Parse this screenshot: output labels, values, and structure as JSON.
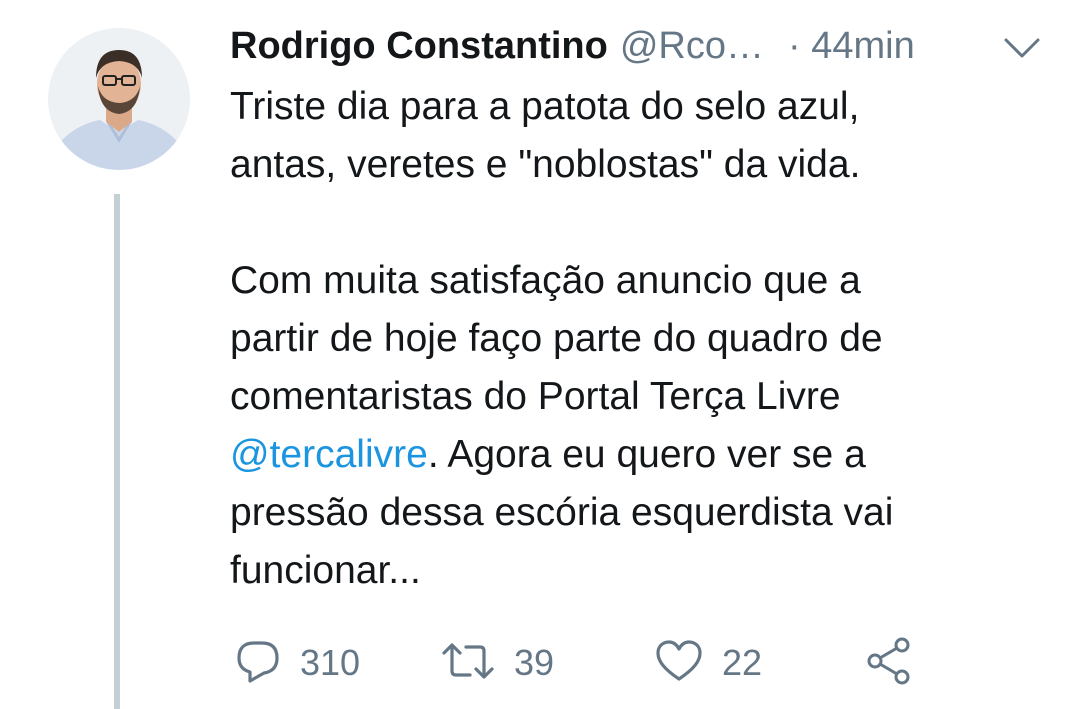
{
  "tweet": {
    "author_name": "Rodrigo Constantino",
    "author_handle": "@Rco…",
    "time": "· 44min",
    "paragraph1_line1": "Triste dia para a patota do selo azul,",
    "paragraph1_line2": "antas, veretes e \"noblostas\" da vida.",
    "paragraph2_line1": "Com muita satisfação anuncio que a",
    "paragraph2_line2": "partir de hoje faço parte do quadro de",
    "paragraph2_line3": "comentaristas do Portal Terça Livre",
    "mention": "@tercalivre",
    "paragraph2_line4_rest": ". Agora eu quero ver se a",
    "paragraph2_line5": "pressão dessa escória esquerdista vai",
    "paragraph2_line6": "funcionar..."
  },
  "actions": {
    "replies": "310",
    "retweets": "39",
    "likes": "22"
  },
  "icons": {
    "reply": "reply-icon",
    "retweet": "retweet-icon",
    "like": "heart-icon",
    "share": "share-icon",
    "more": "chevron-down-icon"
  },
  "colors": {
    "text": "#14171a",
    "secondary": "#657786",
    "link": "#1b95e0",
    "thread_line": "#c4cfd6"
  }
}
